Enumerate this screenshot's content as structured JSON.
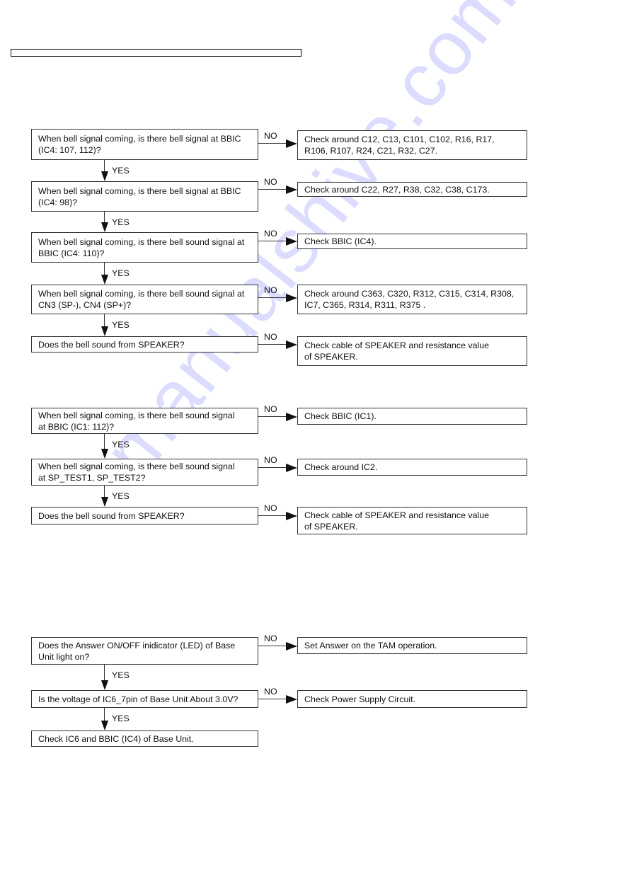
{
  "watermark": "manualshive.com",
  "labels": {
    "yes": "YES",
    "no": "NO"
  },
  "colors": {
    "watermark": "#dcdcff",
    "line": "#333333"
  },
  "flowcharts": [
    {
      "steps": [
        {
          "question": "When bell signal coming, is there bell signal at BBIC\n(IC4: 107, 112)?",
          "no_action": "Check around C12, C13, C101, C102, R16, R17,\nR106, R107, R24, C21, R32, C27."
        },
        {
          "question": "When bell signal coming, is there bell signal at BBIC\n(IC4: 98)?",
          "no_action": "Check around C22, R27, R38, C32, C38, C173."
        },
        {
          "question": "When bell signal coming, is there bell sound signal at\nBBIC (IC4: 110)?",
          "no_action": "Check BBIC (IC4)."
        },
        {
          "question": "When bell signal coming, is there bell sound signal at\nCN3 (SP-), CN4 (SP+)?",
          "no_action": "Check around C363, C320, R312, C315, C314, R308,\nIC7, C365, R314, R311, R375      ."
        },
        {
          "question": "Does the bell sound from SPEAKER?",
          "no_action": "Check cable of SPEAKER and resistance value\nof SPEAKER."
        }
      ]
    },
    {
      "steps": [
        {
          "question": "When bell signal coming, is there bell sound signal\nat BBIC (IC1: 112)?",
          "no_action": "Check BBIC (IC1)."
        },
        {
          "question": "When bell signal coming, is there bell sound signal\nat SP_TEST1, SP_TEST2?",
          "no_action": "Check around IC2."
        },
        {
          "question": "Does the bell sound from SPEAKER?",
          "no_action": "Check cable of SPEAKER and resistance value\nof SPEAKER."
        }
      ]
    },
    {
      "steps": [
        {
          "question": "Does the Answer ON/OFF inidicator (LED) of Base\nUnit light on?",
          "no_action": "Set Answer on the TAM operation."
        },
        {
          "question": "Is the voltage of IC6_7pin of Base Unit About 3.0V?",
          "no_action": "Check Power Supply Circuit."
        },
        {
          "question": "Check IC6 and BBIC (IC4) of Base Unit."
        }
      ]
    }
  ]
}
